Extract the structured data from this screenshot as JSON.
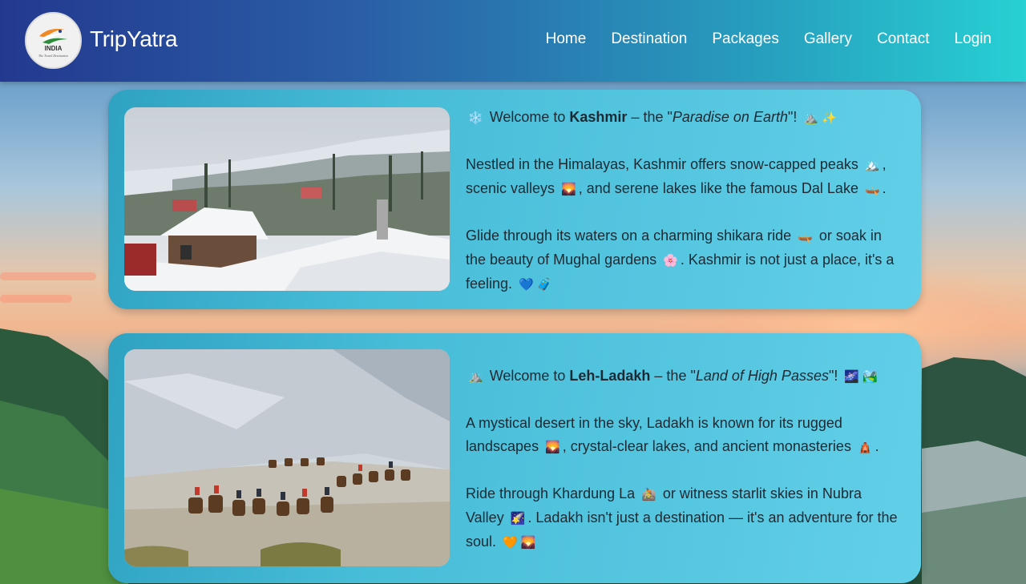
{
  "brand": {
    "logo_text": "INDIA",
    "logo_subtext": "The Travel Destination",
    "name": "TripYatra"
  },
  "nav": {
    "items": [
      {
        "label": "Home"
      },
      {
        "label": "Destination"
      },
      {
        "label": "Packages"
      },
      {
        "label": "Gallery"
      },
      {
        "label": "Contact"
      },
      {
        "label": "Login"
      }
    ]
  },
  "cards": [
    {
      "image_alt": "Snow covered houses in Kashmir",
      "intro_emoji_start": "❄️",
      "intro_prefix": "Welcome to ",
      "intro_name": "Kashmir",
      "intro_mid": " – the \"",
      "intro_tagline": "Paradise on Earth",
      "intro_end": "\"!",
      "intro_emoji_end": "⛰️ ✨",
      "para2_a": "Nestled in the Himalayas, Kashmir offers snow-capped peaks",
      "para2_e1": "🏔️",
      "para2_b": ", scenic valleys",
      "para2_e2": "🌄",
      "para2_c": ", and serene lakes like the famous Dal Lake",
      "para2_e3": "🛶",
      "para2_d": ".",
      "para3_a": "Glide through its waters on a charming shikara ride",
      "para3_e1": "🛶",
      "para3_b": " or soak in the beauty of Mughal gardens",
      "para3_e2": "🌸",
      "para3_c": ". Kashmir is not just a place, it's a feeling.",
      "para3_e3": "💙 🧳"
    },
    {
      "image_alt": "Camel safari in Nubra Valley, Ladakh",
      "intro_emoji_start": "⛰️",
      "intro_prefix": "Welcome to ",
      "intro_name": "Leh-Ladakh",
      "intro_mid": " – the \"",
      "intro_tagline": "Land of High Passes",
      "intro_end": "\"!",
      "intro_emoji_end": "🌌 🏞️",
      "para2_a": "A mystical desert in the sky, Ladakh is known for its rugged landscapes",
      "para2_e1": "🌄",
      "para2_b": ", crystal-clear lakes, and ancient monasteries",
      "para2_e2": "🛕",
      "para2_c": ".",
      "para3_a": "Ride through Khardung La",
      "para3_e1": "🚵",
      "para3_b": " or witness starlit skies in Nubra Valley",
      "para3_e2": "🌠",
      "para3_c": ". Ladakh isn't just a destination — it's an adventure for the soul.",
      "para3_e3": "🧡 🌄"
    }
  ],
  "colors": {
    "header_start": "#23398f",
    "header_end": "#27d0d3",
    "card_start": "#2fa2c2",
    "card_end": "#62cfe8",
    "nav_text": "#ffffff"
  }
}
